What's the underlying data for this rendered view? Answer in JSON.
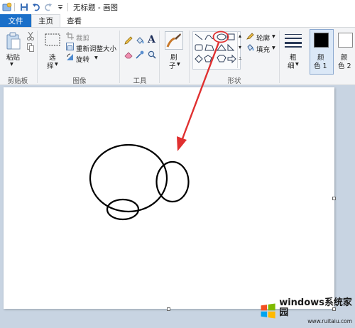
{
  "window": {
    "title": "无标题 - 画图"
  },
  "tabs": {
    "file": "文件",
    "home": "主页",
    "view": "查看"
  },
  "clipboard": {
    "paste": "粘贴",
    "group": "剪贴板"
  },
  "image": {
    "select_line1": "选",
    "select_line2": "择",
    "crop": "裁剪",
    "resize": "重新调整大小",
    "rotate": "旋转",
    "group": "图像"
  },
  "tools": {
    "group": "工具",
    "text_glyph": "A"
  },
  "brushes": {
    "line1": "刷",
    "line2": "子"
  },
  "shapes": {
    "outline": "轮廓",
    "fill": "填充",
    "group": "形状"
  },
  "size": {
    "line1": "粗",
    "line2": "细"
  },
  "colors": {
    "color1_line1": "颜",
    "color1_line2": "色 1",
    "color2_line1": "颜",
    "color2_line2": "色 2",
    "color1_value": "#000000",
    "color2_value": "#ffffff",
    "accent": "#1a6fc9",
    "highlight": "#e03030"
  },
  "watermark": {
    "brand": "windows系统家园",
    "url": "www.ruitaiu.com"
  }
}
